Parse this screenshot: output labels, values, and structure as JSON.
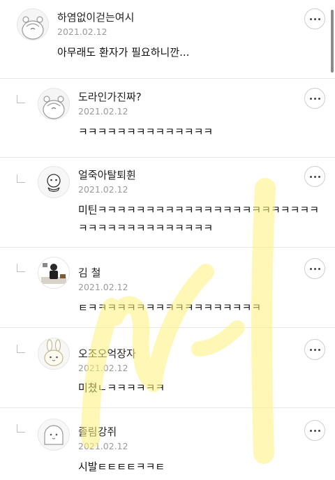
{
  "comments": [
    {
      "author": "하염없이걷는여시",
      "date": "2021.02.12",
      "text": "아무래도 환자가 필요하니깐...",
      "avatar": "hamster-avatar",
      "is_reply": false
    },
    {
      "author": "도라인가진짜?",
      "date": "2021.02.12",
      "text": "ㅋㅋㅋㅋㅋㅋㅋㅋㅋㅋㅋㅋㅋㅋ",
      "avatar": "hamster-avatar",
      "is_reply": true
    },
    {
      "author": "얼죽아탈퇴휜",
      "date": "2021.02.12",
      "text": "미틴ㅋㅋㅋㅋㅋㅋㅋㅋㅋㅋㅋㅋㅋㅋㅋㅋㅋㅋㅋㅋㅋㅋㅋㅋㅋㅋㅋㅋㅋㅋㅋㅋㅋㅋㅋㅋㅋ",
      "avatar": "character-avatar",
      "is_reply": true
    },
    {
      "author": "김 철",
      "date": "2021.02.12",
      "text": "ㅌㅋㅋㅋㅋㅋㅋㅋㅋㅋㅋㅋㅋㅋㅋㅋㅋㅋㅋ",
      "avatar": "photo-avatar",
      "is_reply": true
    },
    {
      "author": "오조오억장자",
      "date": "2021.02.12",
      "text": "미쳤ㄴㅋㅋㅋㅋㅋㅋ",
      "avatar": "rabbit-avatar",
      "is_reply": true
    },
    {
      "author": "졸림강쥐",
      "date": "2021.02.12",
      "text": "시발ㅌㅌㅌㅌㅋㅋㅌ",
      "avatar": "ghost-avatar",
      "is_reply": true
    }
  ],
  "more_icon": "ellipsis-icon",
  "reply_icon": "reply-arrow-icon",
  "colors": {
    "divider": "#e8e8e8",
    "date": "#9a9a9a",
    "watermark": "#fff27a"
  }
}
